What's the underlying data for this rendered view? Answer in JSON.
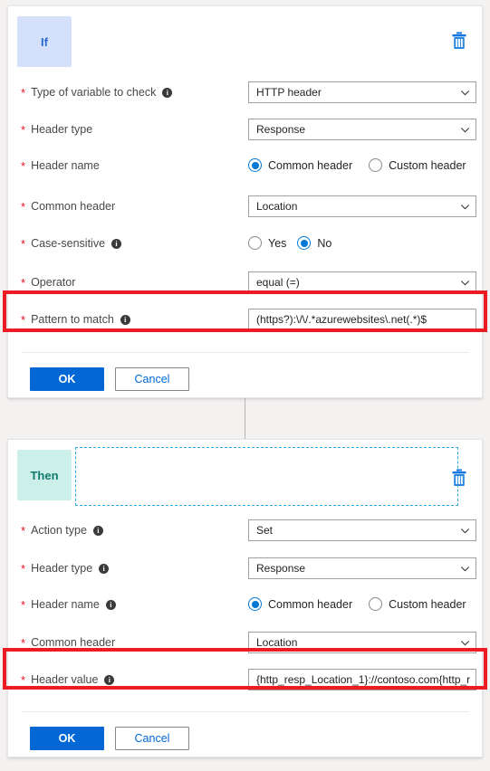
{
  "colors": {
    "accent": "#0078d4",
    "primary_button": "#0067d5",
    "highlight": "#ed1c24",
    "required": "#e81123",
    "if_badge_bg": "#d5e0fb",
    "if_badge_text": "#2c6ad0",
    "then_badge_bg": "#cdefea",
    "then_badge_text": "#107a6d",
    "page_bg": "#f3f2f1",
    "dashed_border": "#28a8e0"
  },
  "if_card": {
    "badge": "If",
    "delete_icon": "trash-icon",
    "rows": [
      {
        "label": "Type of variable to check",
        "required": true,
        "info": true,
        "control": "dropdown",
        "value": "HTTP header"
      },
      {
        "label": "Header type",
        "required": true,
        "info": false,
        "control": "dropdown",
        "value": "Response"
      },
      {
        "label": "Header name",
        "required": true,
        "info": false,
        "control": "radio",
        "options": [
          {
            "label": "Common header",
            "selected": true
          },
          {
            "label": "Custom header",
            "selected": false
          }
        ]
      },
      {
        "label": "Common header",
        "required": true,
        "info": false,
        "control": "dropdown",
        "value": "Location"
      },
      {
        "label": "Case-sensitive",
        "required": true,
        "info": true,
        "control": "radio",
        "options": [
          {
            "label": "Yes",
            "selected": false
          },
          {
            "label": "No",
            "selected": true
          }
        ]
      },
      {
        "label": "Operator",
        "required": true,
        "info": false,
        "control": "dropdown",
        "value": "equal (=)"
      },
      {
        "label": "Pattern to match",
        "required": true,
        "info": true,
        "control": "textbox",
        "value": "(https?):\\/\\/.*azurewebsites\\.net(.*)$",
        "highlighted": true
      }
    ],
    "buttons": {
      "ok": "OK",
      "cancel": "Cancel"
    }
  },
  "then_card": {
    "badge": "Then",
    "delete_icon": "trash-icon",
    "dropzone": "",
    "rows": [
      {
        "label": "Action type",
        "required": true,
        "info": true,
        "control": "dropdown",
        "value": "Set"
      },
      {
        "label": "Header type",
        "required": true,
        "info": true,
        "control": "dropdown",
        "value": "Response"
      },
      {
        "label": "Header name",
        "required": true,
        "info": true,
        "control": "radio",
        "options": [
          {
            "label": "Common header",
            "selected": true
          },
          {
            "label": "Custom header",
            "selected": false
          }
        ]
      },
      {
        "label": "Common header",
        "required": true,
        "info": false,
        "control": "dropdown",
        "value": "Location"
      },
      {
        "label": "Header value",
        "required": true,
        "info": true,
        "control": "textbox",
        "value": "{http_resp_Location_1}://contoso.com{http_r...",
        "highlighted": true
      }
    ],
    "buttons": {
      "ok": "OK",
      "cancel": "Cancel"
    }
  }
}
